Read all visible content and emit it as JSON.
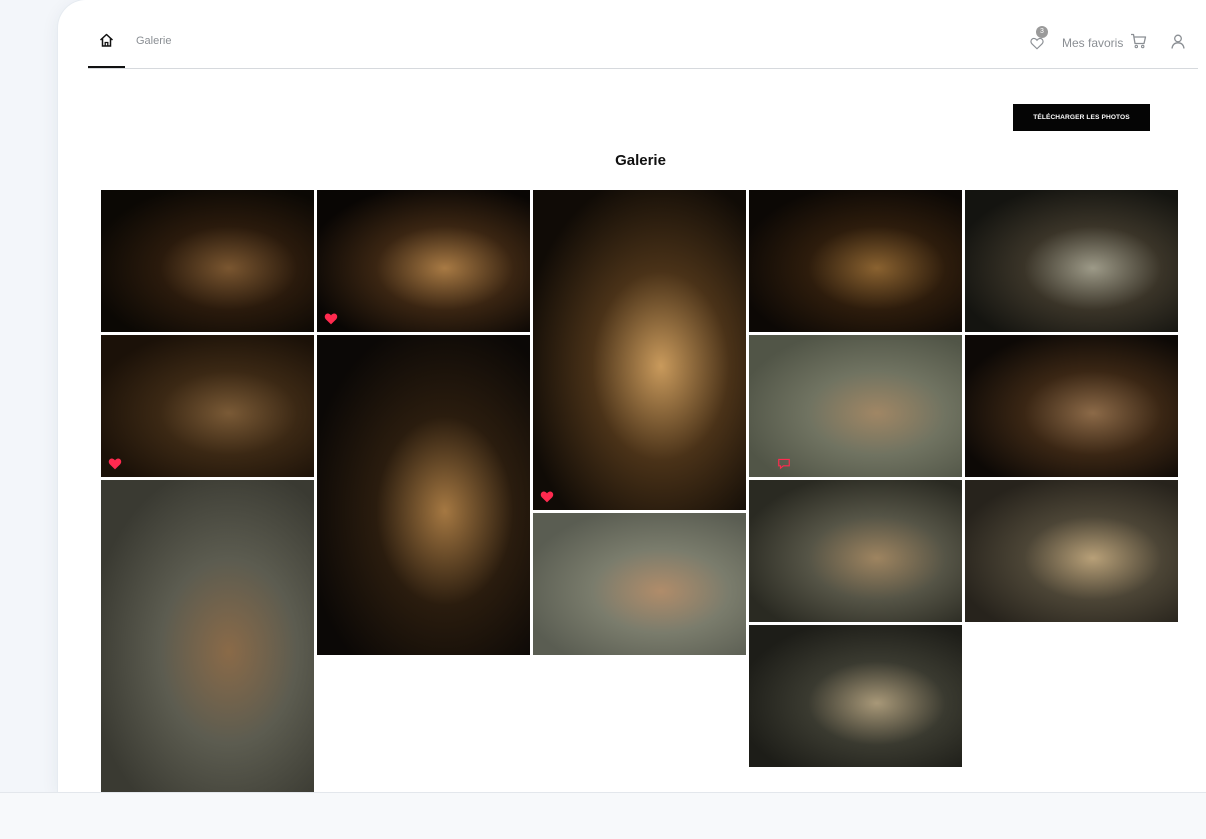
{
  "nav": {
    "breadcrumb": "Galerie",
    "favorites_label": "Mes favoris",
    "favorites_count": "3"
  },
  "actions": {
    "download_label": "TÉLÉCHARGER LES PHOTOS"
  },
  "gallery": {
    "title": "Galerie",
    "photos": [
      {
        "name": "photo-1",
        "favorite": false,
        "colors": [
          "#0b0804",
          "#2a1a0c",
          "#7a5630"
        ]
      },
      {
        "name": "photo-2",
        "favorite": true,
        "colors": [
          "#090604",
          "#3a2512",
          "#a87a44"
        ]
      },
      {
        "name": "photo-3",
        "favorite": true,
        "colors": [
          "#100b06",
          "#4a3218",
          "#c99a5c"
        ]
      },
      {
        "name": "photo-4",
        "favorite": false,
        "colors": [
          "#0c0805",
          "#2d1c0c",
          "#8a6230"
        ]
      },
      {
        "name": "photo-5",
        "favorite": false,
        "colors": [
          "#141410",
          "#3a3428",
          "#9d9a88"
        ]
      },
      {
        "name": "photo-6",
        "favorite": true,
        "colors": [
          "#1b1108",
          "#3b2814",
          "#7a5a36"
        ]
      },
      {
        "name": "photo-7",
        "favorite": false,
        "colors": [
          "#0b0806",
          "#2a1c0e",
          "#a57842"
        ]
      },
      {
        "name": "photo-8",
        "favorite": false,
        "colors": [
          "#515547",
          "#707361",
          "#a08664"
        ]
      },
      {
        "name": "photo-9",
        "favorite": false,
        "colors": [
          "#0d0906",
          "#3a2614",
          "#8c6a48"
        ]
      },
      {
        "name": "photo-10",
        "favorite": false,
        "colors": [
          "#5a5d52",
          "#7a7c6c",
          "#b08c6a"
        ]
      },
      {
        "name": "photo-11",
        "favorite": false,
        "colors": [
          "#3a3a32",
          "#5c5c50",
          "#8a6a48"
        ]
      },
      {
        "name": "photo-12",
        "favorite": false,
        "colors": [
          "#2a2a22",
          "#555446",
          "#9e8460"
        ]
      },
      {
        "name": "photo-13",
        "favorite": false,
        "colors": [
          "#27231c",
          "#4c4536",
          "#b8a078"
        ]
      },
      {
        "name": "photo-14",
        "favorite": false,
        "colors": [
          "#1d1d18",
          "#3a3a30",
          "#a89878"
        ]
      }
    ]
  }
}
